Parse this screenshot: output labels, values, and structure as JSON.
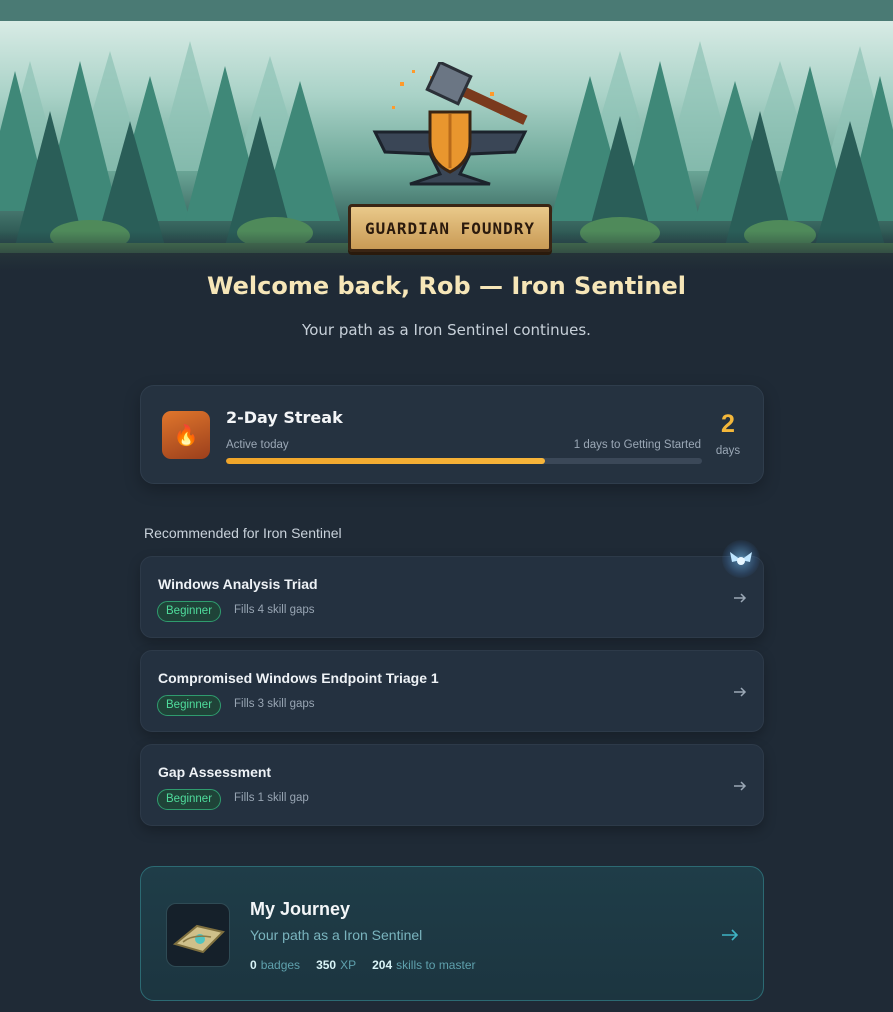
{
  "brand": {
    "banner_text": "GUARDIAN FOUNDRY"
  },
  "welcome": {
    "title": "Welcome back, Rob — Iron Sentinel",
    "subtitle": "Your path as a Iron Sentinel continues."
  },
  "streak": {
    "icon": "flame-icon",
    "title": "2-Day Streak",
    "status": "Active today",
    "goal_text": "1 days to Getting Started",
    "progress": 0.67,
    "count": "2",
    "unit": "days"
  },
  "recommended": {
    "heading": "Recommended for Iron Sentinel",
    "items": [
      {
        "title": "Windows Analysis Triad",
        "level": "Beginner",
        "gaps": "Fills 4 skill gaps"
      },
      {
        "title": "Compromised Windows Endpoint Triage 1",
        "level": "Beginner",
        "gaps": "Fills 3 skill gaps"
      },
      {
        "title": "Gap Assessment",
        "level": "Beginner",
        "gaps": "Fills 1 skill gap"
      }
    ]
  },
  "journey": {
    "title": "My Journey",
    "subtitle": "Your path as a Iron Sentinel",
    "badges_count": "0",
    "badges_label": "badges",
    "xp_count": "350",
    "xp_label": "XP",
    "skills_count": "204",
    "skills_label": "skills to master"
  },
  "colors": {
    "accent_gold": "#f4b73a",
    "pill_green": "#4fdc9c",
    "background": "#1f2a36"
  }
}
